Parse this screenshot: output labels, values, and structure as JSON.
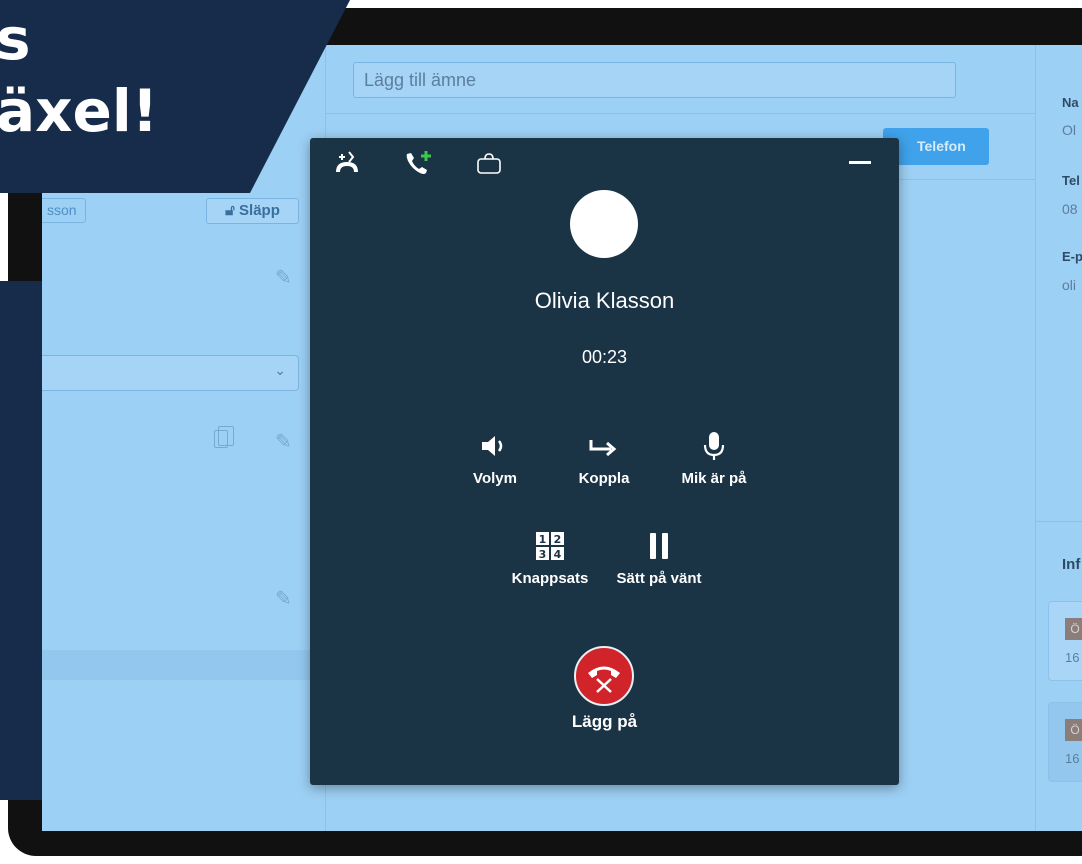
{
  "banner": {
    "line1": "s",
    "line2": "äxel!"
  },
  "left_panel": {
    "name_tag": "sson",
    "release_button": "Släpp"
  },
  "middle_panel": {
    "subject_placeholder": "Lägg till ämne",
    "phone_button": "Telefon"
  },
  "right_panel": {
    "name_label": "Na",
    "name_value": "Ol",
    "phone_label": "Tel",
    "phone_value": "08",
    "email_label": "E-p",
    "email_value": "oli",
    "section_title": "Inf",
    "cards": [
      {
        "badge": "Ö",
        "number": "16"
      },
      {
        "badge": "Ö",
        "number": "16"
      }
    ]
  },
  "call": {
    "caller_name": "Olivia Klasson",
    "duration": "00:23",
    "controls": [
      {
        "label": "Volym",
        "icon": "speaker-icon"
      },
      {
        "label": "Koppla",
        "icon": "transfer-arrow-icon"
      },
      {
        "label": "Mik är på",
        "icon": "microphone-icon"
      },
      {
        "label": "Knappsats",
        "icon": "keypad-icon"
      },
      {
        "label": "Sätt på vänt",
        "icon": "pause-icon"
      }
    ],
    "keypad_digits": [
      "1",
      "2",
      "3",
      "4"
    ],
    "hangup_label": "Lägg på",
    "colors": {
      "dialog_bg": "#1a3345",
      "hangup": "#d0232a",
      "add_call_plus": "#3cc94b"
    }
  }
}
